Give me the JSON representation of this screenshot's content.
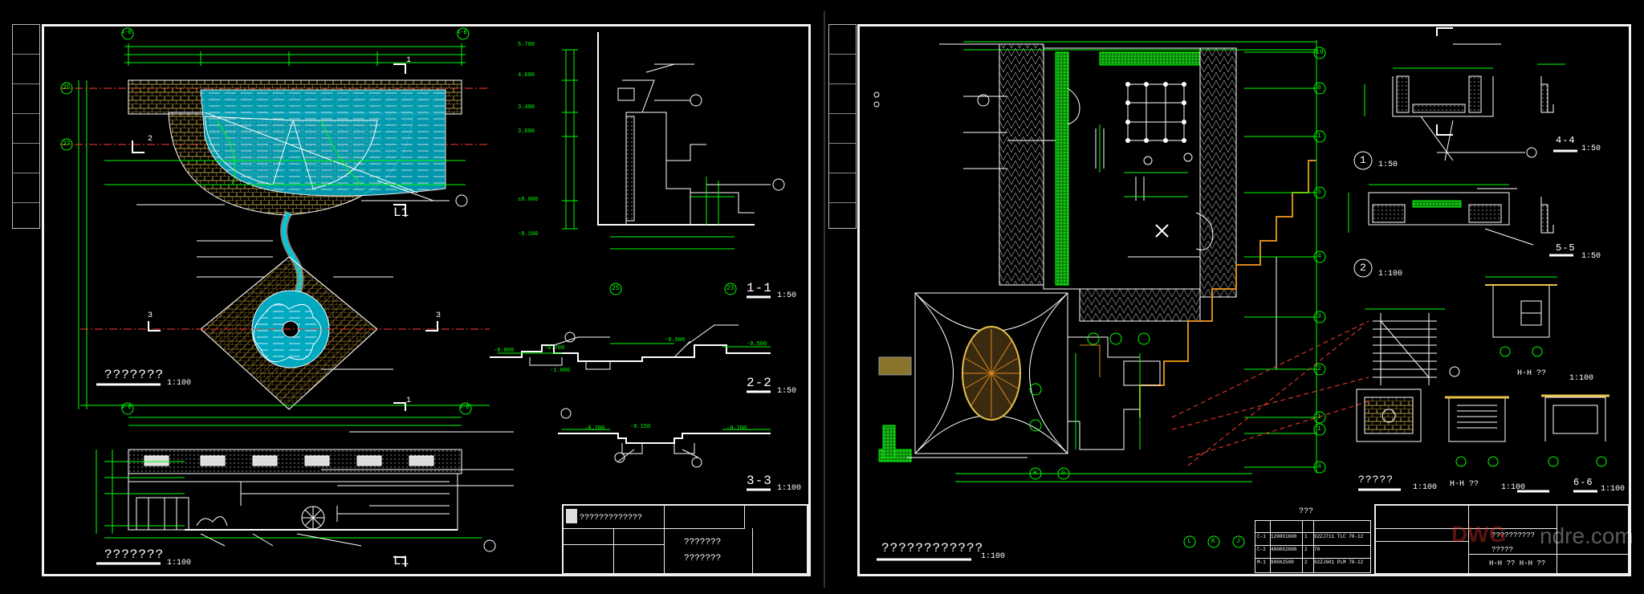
{
  "left_sheet": {
    "plan_title": "???????",
    "plan_scale": "1:100",
    "elev_title": "???????",
    "elev_scale": "1:100",
    "sec11_title": "1-1",
    "sec11_scale": "1:50",
    "sec22_title": "2-2",
    "sec22_scale": "1:50",
    "sec33_title": "3-3",
    "sec33_scale": "1:100",
    "title_block_label": "?????????????",
    "title_block_name1": "???????",
    "title_block_name2": "???????",
    "cut_marks": [
      "1",
      "1",
      "2",
      "3",
      "3",
      "1",
      "1",
      "L1",
      "L1"
    ],
    "axis_labels": [
      "A-B",
      "A-B",
      "25",
      "23",
      "A-B",
      "A-B",
      "25",
      "23"
    ],
    "levels": [
      "5.700",
      "4.600",
      "3.400",
      "3.000",
      "±0.000",
      "-0.100",
      "-0.800",
      "-0.700",
      "-0.600",
      "-0.500",
      "-0.150",
      "-0.700",
      "-1.000",
      "-0.700"
    ]
  },
  "right_sheet": {
    "plan_title": "????????????",
    "plan_scale": "1:100",
    "detail1": "1",
    "detail1_scale": "1:50",
    "detail2": "2",
    "detail2_scale": "1:100",
    "sec44_title": "4-4",
    "sec44_scale": "1:50",
    "sec55_title": "5-5",
    "sec55_scale": "1:50",
    "sec66_title": "6-6",
    "sec66_scale": "1:100",
    "elev_hh_title": "H-H ??",
    "elev_hh_scale": "1:100",
    "pergola_title": "?????",
    "pergola_scale": "1:100",
    "hh2_title": "H-H ??",
    "hh2_scale": "1:100",
    "schedule_title": "???",
    "schedule_rows": [
      [
        "C-1",
        "1200X1600",
        "1",
        "92ZJ711 TLC 70-12"
      ],
      [
        "C-2",
        "4800X2600",
        "2",
        "70"
      ],
      [
        "M-1",
        "900X2500",
        "2",
        "92ZJ601 PLM 70-12"
      ]
    ],
    "title_block_label": "??????????",
    "title_block_name1": "?????",
    "title_block_name2": "H-H ??  H-H ??",
    "watermark_brand": "DWG",
    "watermark_site": "ndre.com",
    "grid_labels": [
      "19",
      "6",
      "1",
      "5",
      "4",
      "3",
      "2",
      "1",
      "1",
      "4",
      "L",
      "K",
      "J",
      "H",
      "G"
    ]
  },
  "colors": {
    "line_white": "#ffffff",
    "dim_green": "#00ff00",
    "cut_red": "#ff3b2f",
    "water_cyan": "#00c8d8",
    "brick_yellow": "#e7c24a",
    "hatch_orange": "#d98a1a",
    "sheet_border": "#f2f2f2"
  }
}
